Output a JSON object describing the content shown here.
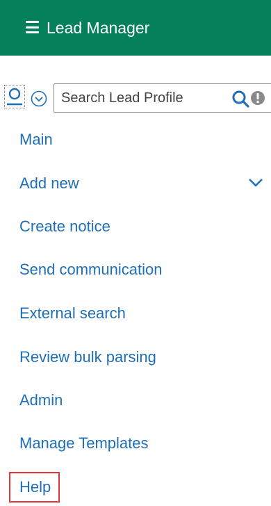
{
  "header": {
    "menu_icon": "hamburger-menu-icon",
    "title": "Lead Manager",
    "background_color": "#04805a"
  },
  "toolbar": {
    "user_icon": "user-icon",
    "dropdown_icon": "circle-chevron-down-icon",
    "search": {
      "value": "",
      "placeholder": "Search Lead Profile"
    },
    "search_icon": "search-icon",
    "info_icon": "info-icon"
  },
  "nav": {
    "link_color": "#1f6fb7",
    "items": [
      {
        "label": "Main"
      },
      {
        "label": "Add new",
        "has_submenu": true
      },
      {
        "label": "Create notice"
      },
      {
        "label": "Send communication"
      },
      {
        "label": "External search"
      },
      {
        "label": "Review bulk parsing"
      },
      {
        "label": "Admin"
      },
      {
        "label": "Manage Templates"
      },
      {
        "label": "Help",
        "highlighted": true
      }
    ]
  },
  "highlight_color": "#e0353a"
}
